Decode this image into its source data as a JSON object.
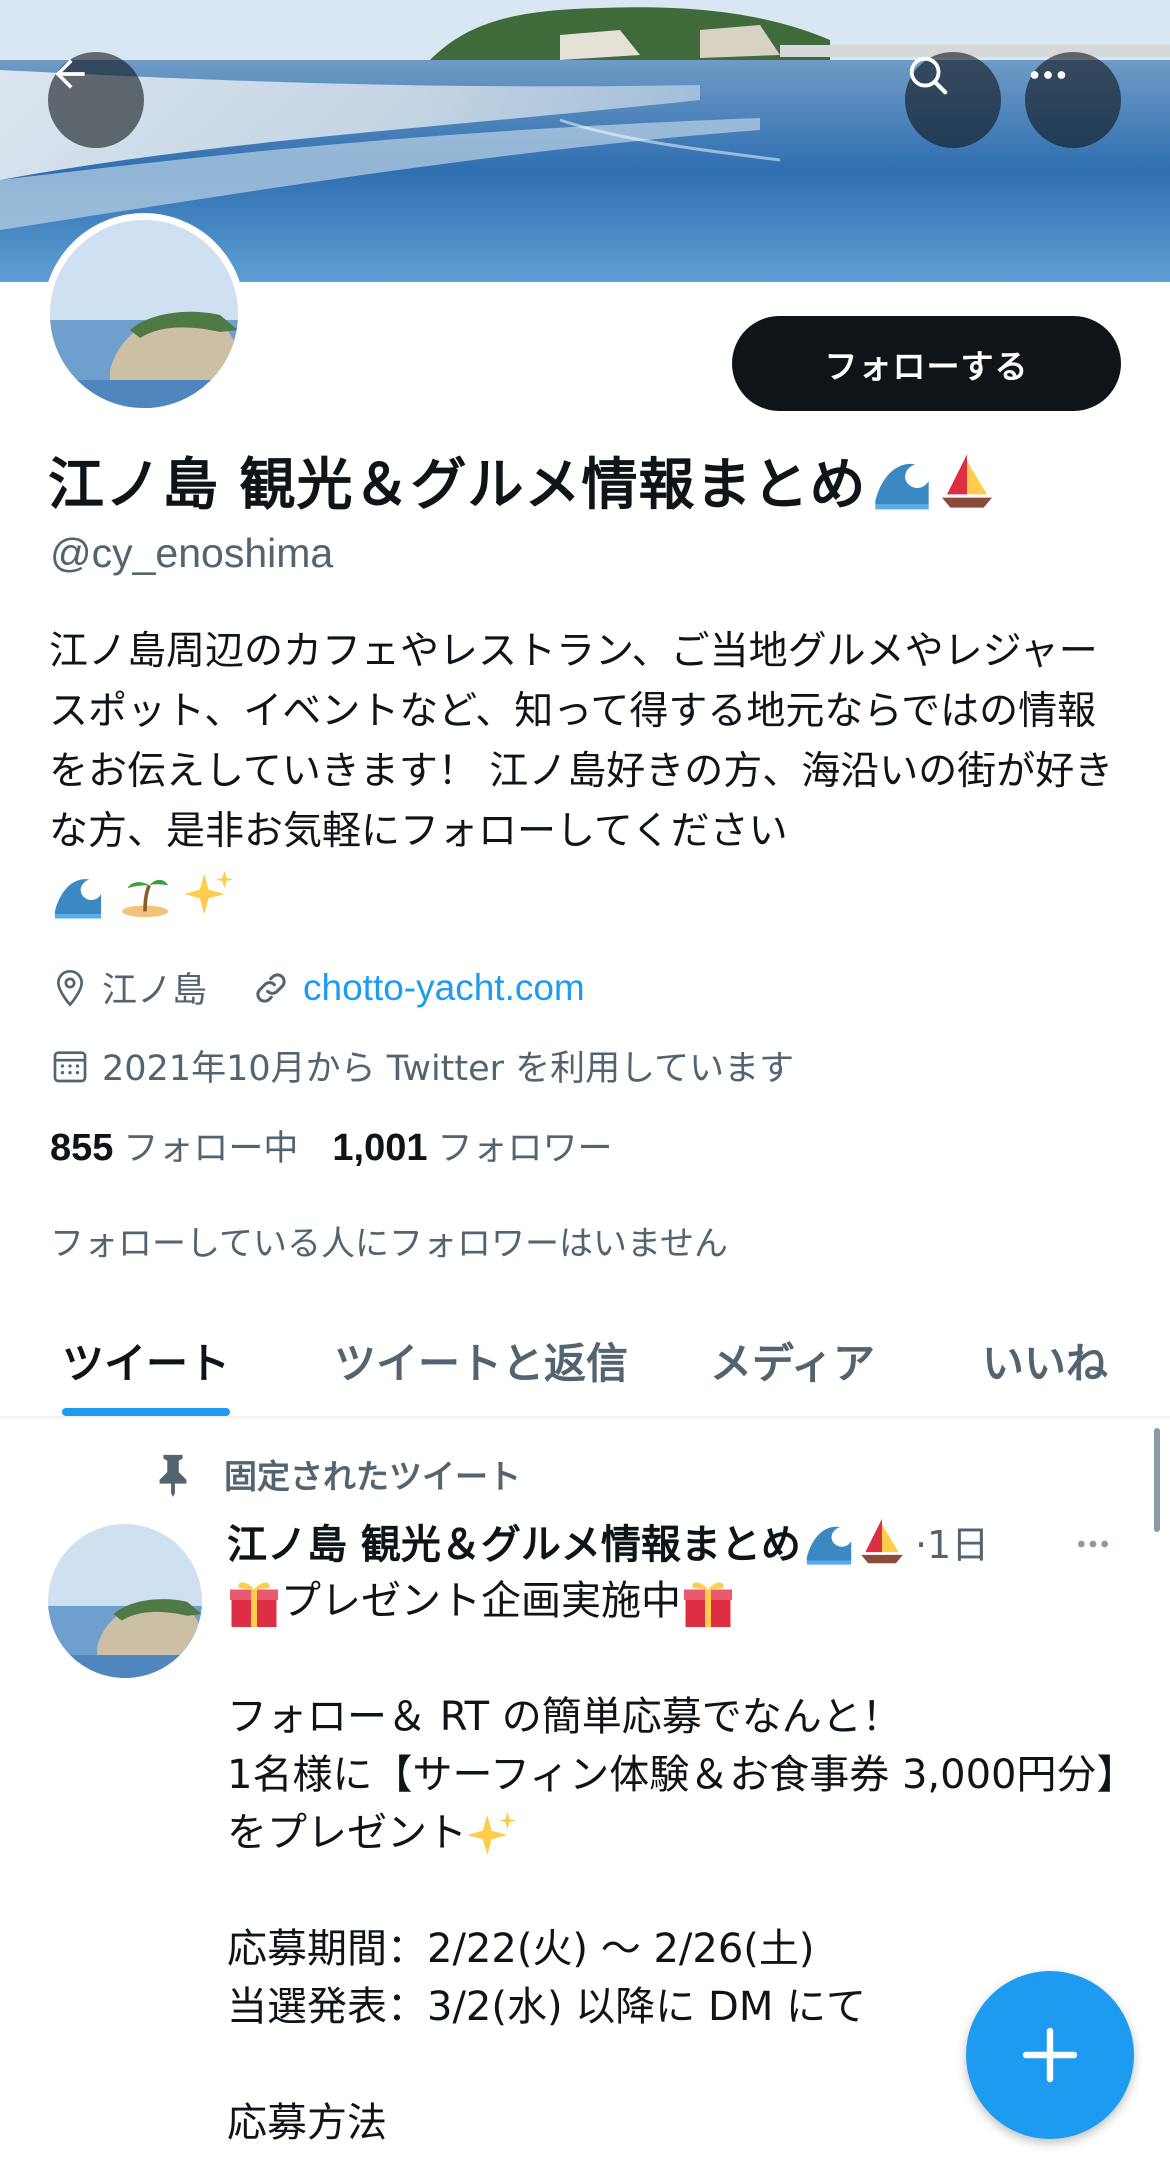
{
  "header": {
    "back_icon": "arrow-left-icon",
    "search_icon": "search-icon",
    "more_icon": "more-horizontal-icon"
  },
  "profile": {
    "follow_label": "フォローする",
    "display_name": "江ノ島 観光＆グルメ情報まとめ",
    "display_name_emojis": [
      "wave-icon",
      "sailboat-icon"
    ],
    "handle": "@cy_enoshima",
    "bio": "江ノ島周辺のカフェやレストラン、ご当地グルメやレジャースポット、イベントなど、知って得する地元ならではの情報をお伝えしていきます！ 江ノ島好きの方、海沿いの街が好きな方、是非お気軽にフォローしてください",
    "bio_emojis": [
      "wave-icon",
      "island-icon",
      "sparkles-icon"
    ],
    "location": "江ノ島",
    "website": "chotto-yacht.com",
    "joined": "2021年10月から Twitter を利用しています",
    "following_count": "855",
    "following_label": "フォロー中",
    "followers_count": "1,001",
    "followers_label": "フォロワー",
    "no_followers_known": "フォローしている人にフォロワーはいません"
  },
  "tabs": [
    {
      "label": "ツイート",
      "active": true
    },
    {
      "label": "ツイートと返信",
      "active": false
    },
    {
      "label": "メディア",
      "active": false
    },
    {
      "label": "いいね",
      "active": false
    }
  ],
  "pinned_tweet": {
    "pinned_label": "固定されたツイート",
    "author": "江ノ島 観光＆グルメ情報まとめ",
    "time": "·1日",
    "line1": "プレゼント企画実施中",
    "body": "フォロー＆ RT の簡単応募でなんと！\n1名様に【サーフィン体験＆お食事券 3,000円分】をプレゼント",
    "period": "応募期間：2/22(火) ～ 2/26(土)\n当選発表：3/2(水) 以降に DM にて",
    "method": "応募方法"
  },
  "colors": {
    "accent": "#1d9bf0",
    "text": "#0f1419",
    "secondary": "#536471",
    "follow_bg": "#0f1419"
  }
}
